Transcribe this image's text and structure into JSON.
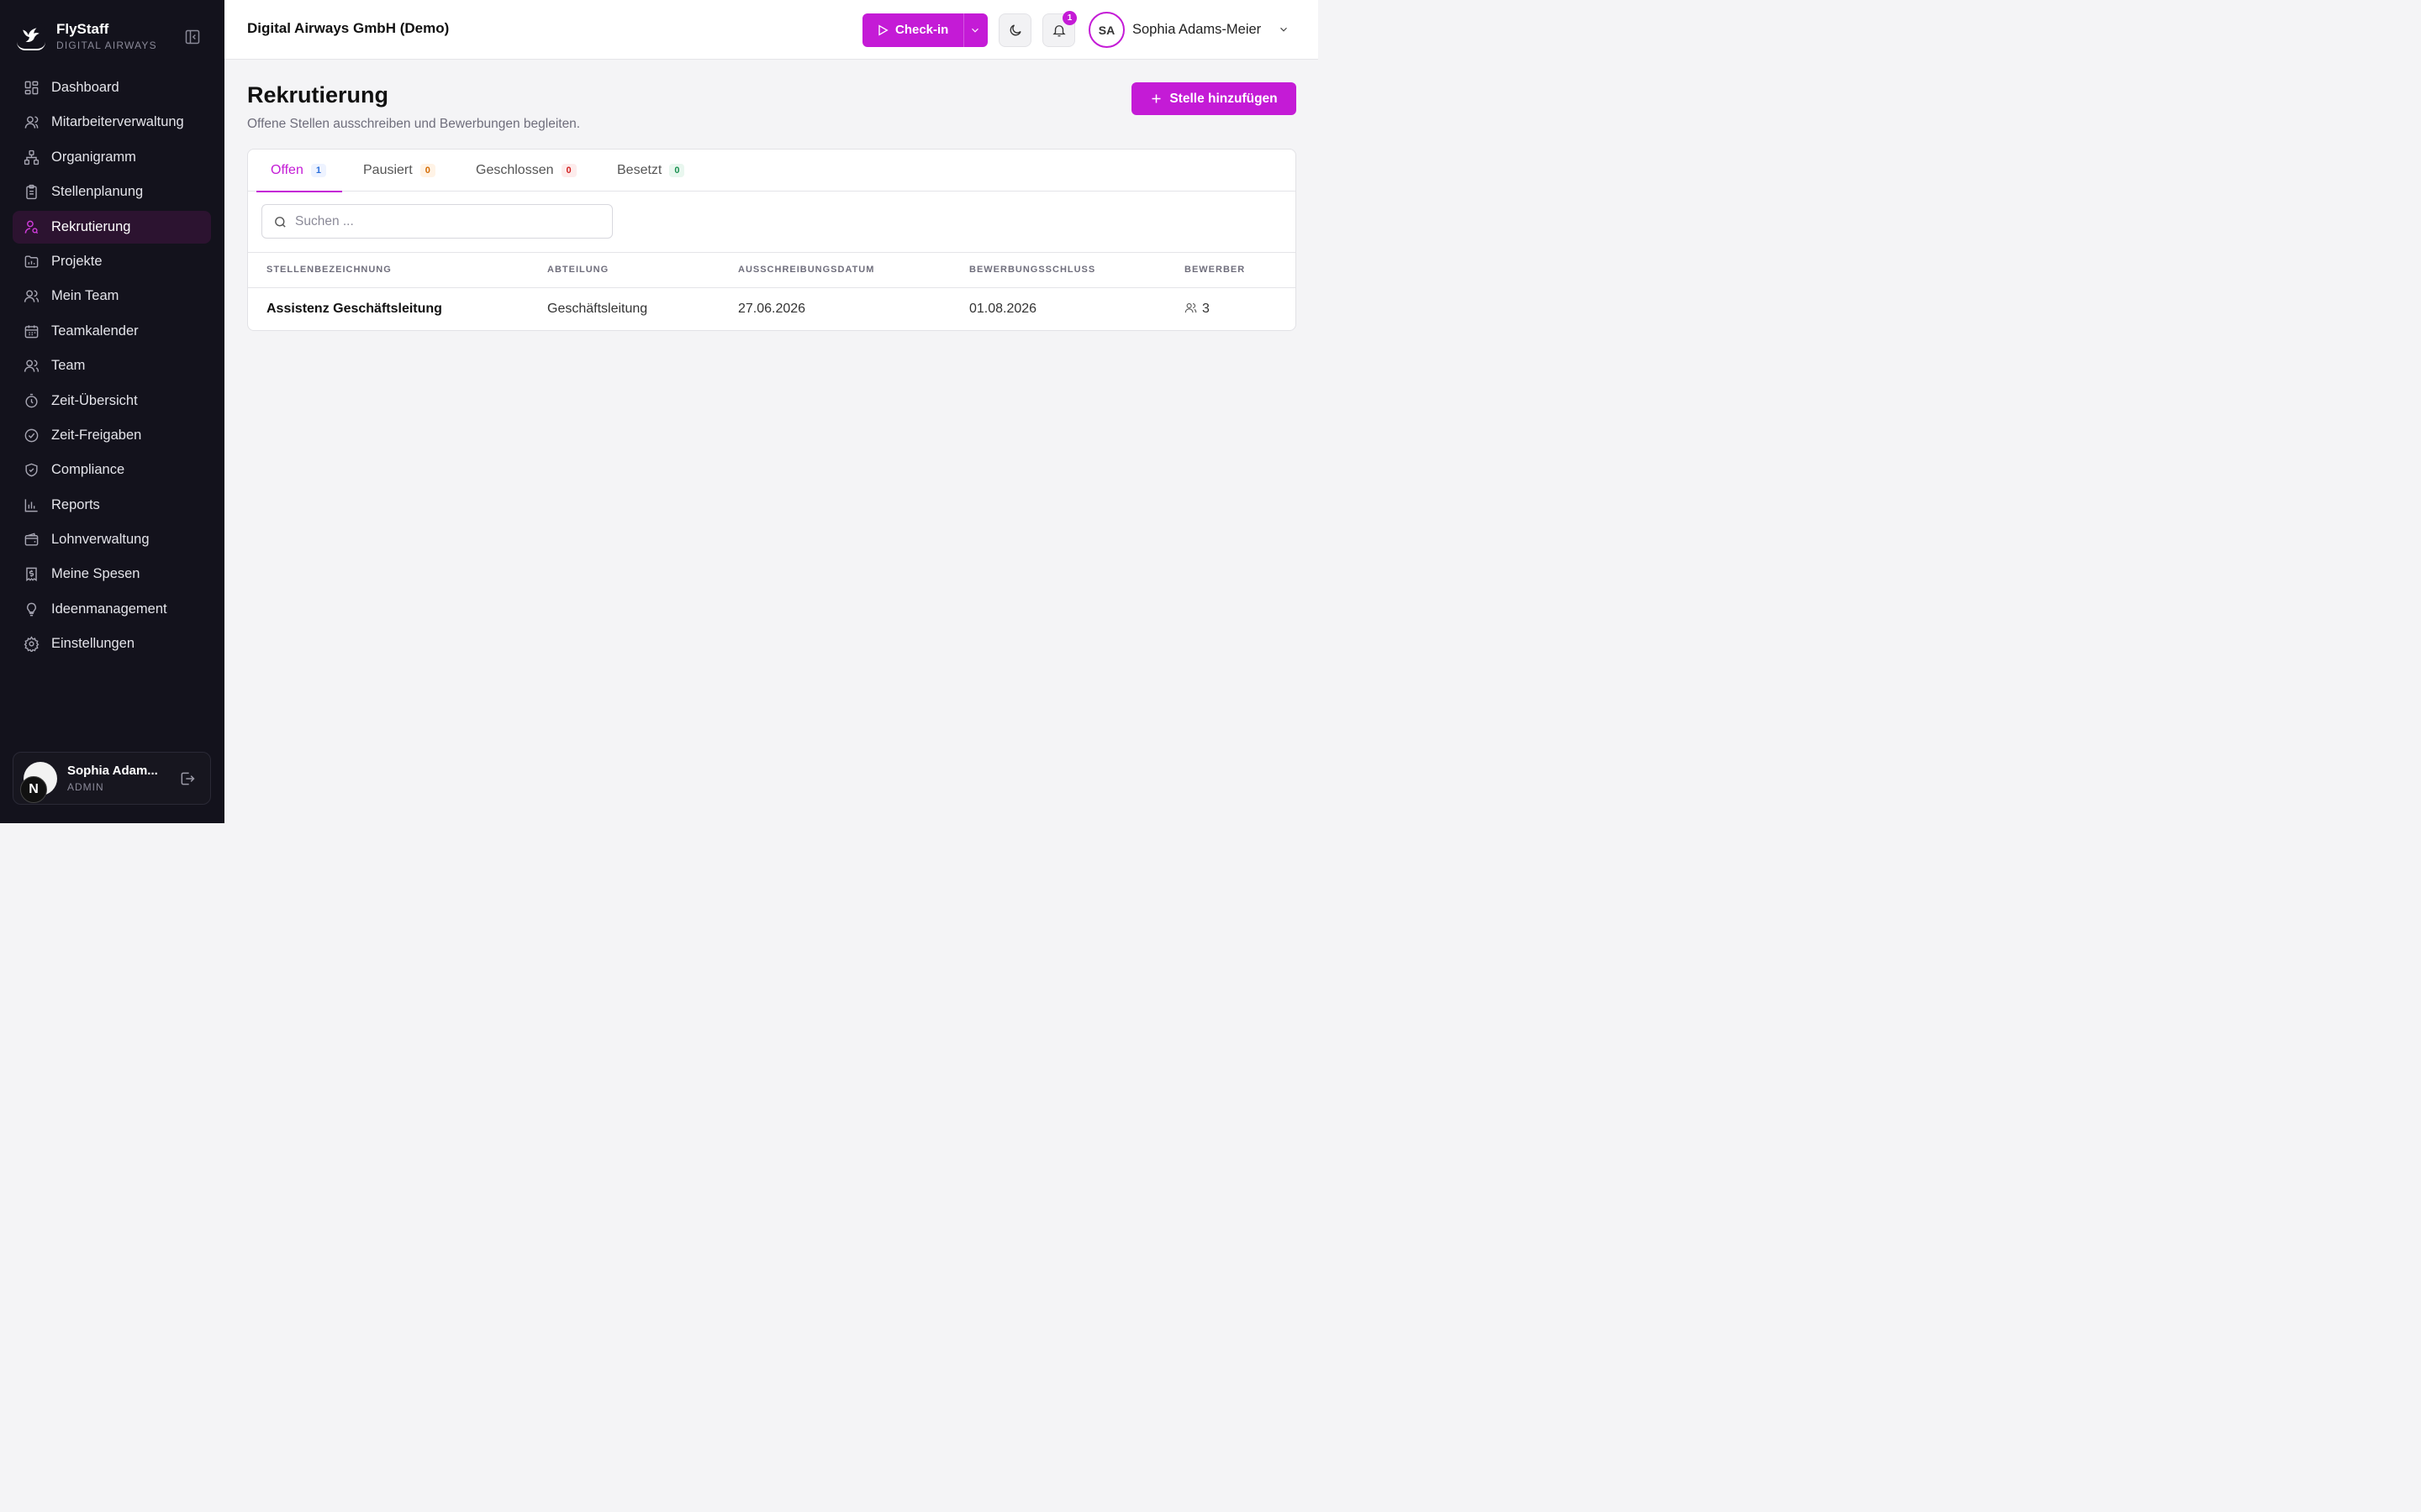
{
  "brand": {
    "name": "FlyStaff",
    "subtitle": "DIGITAL AIRWAYS"
  },
  "sidebar": {
    "items": [
      {
        "label": "Dashboard",
        "icon": "dashboard-icon"
      },
      {
        "label": "Mitarbeiterverwaltung",
        "icon": "user-icon"
      },
      {
        "label": "Organigramm",
        "icon": "org-chart-icon"
      },
      {
        "label": "Stellenplanung",
        "icon": "clipboard-icon"
      },
      {
        "label": "Rekrutierung",
        "icon": "user-search-icon",
        "active": true
      },
      {
        "label": "Projekte",
        "icon": "folder-chart-icon"
      },
      {
        "label": "Mein Team",
        "icon": "users-icon"
      },
      {
        "label": "Teamkalender",
        "icon": "calendar-icon"
      },
      {
        "label": "Team",
        "icon": "users-icon"
      },
      {
        "label": "Zeit-Übersicht",
        "icon": "timer-icon"
      },
      {
        "label": "Zeit-Freigaben",
        "icon": "check-circle-icon"
      },
      {
        "label": "Compliance",
        "icon": "shield-check-icon"
      },
      {
        "label": "Reports",
        "icon": "bar-chart-icon"
      },
      {
        "label": "Lohnverwaltung",
        "icon": "wallet-icon"
      },
      {
        "label": "Meine Spesen",
        "icon": "receipt-icon"
      },
      {
        "label": "Ideenmanagement",
        "icon": "lightbulb-icon"
      },
      {
        "label": "Einstellungen",
        "icon": "gear-icon"
      }
    ],
    "user": {
      "name": "Sophia Adam...",
      "role": "ADMIN",
      "badge": "N"
    }
  },
  "header": {
    "company": "Digital Airways GmbH (Demo)",
    "checkin_label": "Check-in",
    "notification_count": "1",
    "avatar_initials": "SA",
    "user_name": "Sophia Adams-Meier"
  },
  "page": {
    "title": "Rekrutierung",
    "subtitle": "Offene Stellen ausschreiben und Bewerbungen begleiten.",
    "add_button": "Stelle hinzufügen"
  },
  "tabs": [
    {
      "label": "Offen",
      "count": "1",
      "active": true
    },
    {
      "label": "Pausiert",
      "count": "0"
    },
    {
      "label": "Geschlossen",
      "count": "0"
    },
    {
      "label": "Besetzt",
      "count": "0"
    }
  ],
  "search": {
    "placeholder": "Suchen ...",
    "value": ""
  },
  "table": {
    "columns": [
      "STELLENBEZEICHNUNG",
      "ABTEILUNG",
      "AUSSCHREIBUNGSDATUM",
      "BEWERBUNGSSCHLUSS",
      "BEWERBER"
    ],
    "rows": [
      {
        "title": "Assistenz Geschäftsleitung",
        "department": "Geschäftsleitung",
        "posted": "27.06.2026",
        "deadline": "01.08.2026",
        "applicants": "3"
      }
    ]
  },
  "colors": {
    "accent": "#c41bd6",
    "sidebar_bg": "#13121c",
    "active_item_bg": "#2c1330"
  }
}
